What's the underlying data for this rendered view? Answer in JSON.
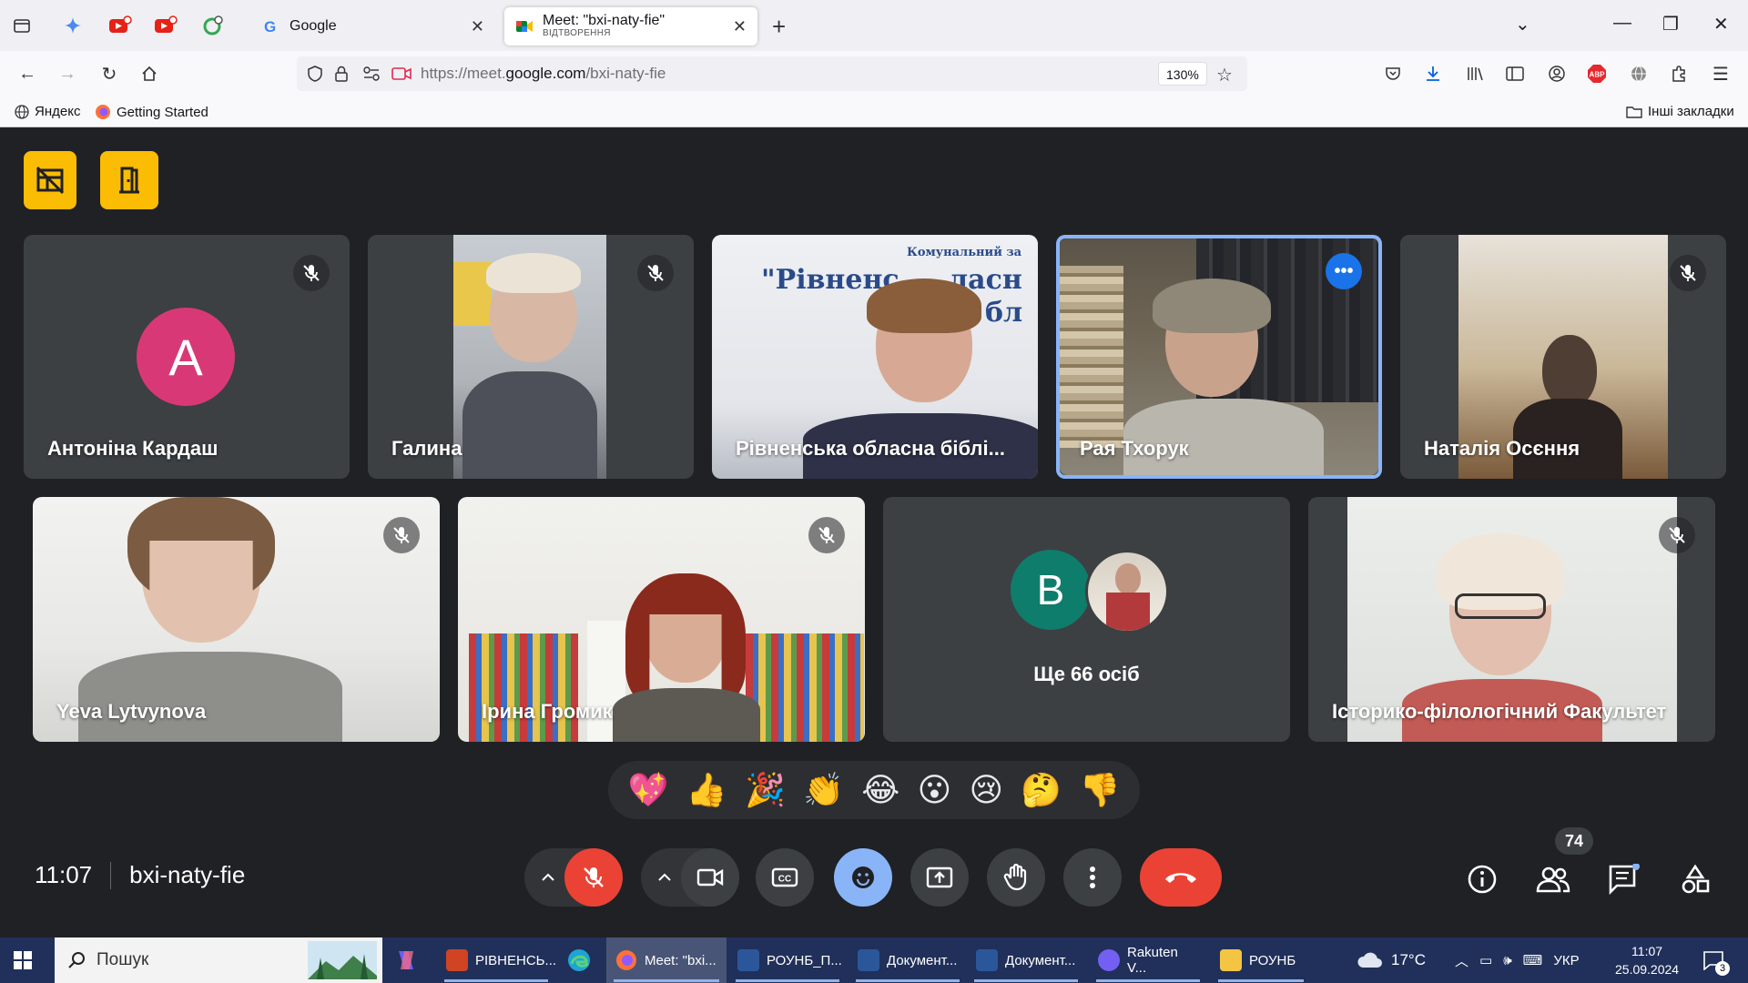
{
  "browser": {
    "tabs": [
      {
        "title": "Google"
      },
      {
        "title": "Meet: \"bxi-naty-fie\"",
        "subtitle": "ВІДТВОРЕННЯ"
      }
    ],
    "url_prefix": "https://meet.",
    "url_domain": "google.com",
    "url_path": "/bxi-naty-fie",
    "zoom": "130%",
    "bookmarks": [
      {
        "label": "Яндекс"
      },
      {
        "label": "Getting Started"
      }
    ],
    "other_bookmarks": "Інші закладки",
    "abp_badge": "ABP"
  },
  "meet": {
    "participants_row1": [
      {
        "name": "Антоніна Кардаш",
        "avatar_letter": "A",
        "avatar_color": "#d93877"
      },
      {
        "name": "Галина"
      },
      {
        "name": "Рівненська обласна біблі..."
      },
      {
        "name": "Рая Тхорук"
      },
      {
        "name": "Наталія Осєння"
      }
    ],
    "participants_row2": [
      {
        "name": "Yeva Lytvynova"
      },
      {
        "name": "Ірина Громик"
      },
      {
        "name": "Ще 66 осіб",
        "avatar_letter": "B",
        "avatar_color": "#0f7d6b"
      },
      {
        "name": "Історико-філологічний Факультет"
      }
    ],
    "background_sign": {
      "line1": "Комунальний за",
      "line2": "\"Рівненс",
      "line3": "ласн",
      "line4": "бл"
    },
    "reactions": [
      "💖",
      "👍",
      "🎉",
      "👏",
      "😂",
      "😮",
      "😢",
      "🤔",
      "👎"
    ],
    "time": "11:07",
    "meeting_code": "bxi-naty-fie",
    "participant_count": "74",
    "accent_colors": {
      "end_call": "#ea4335",
      "mic_off": "#ea4335",
      "reactions_active": "#8ab4f8",
      "highlight": "#fbbc04"
    }
  },
  "taskbar": {
    "search_placeholder": "Пошук",
    "apps": [
      {
        "label": "РІВНЕНСЬ..."
      },
      {
        "label": "Meet: \"bxi..."
      },
      {
        "label": "РОУНБ_П..."
      },
      {
        "label": "Документ..."
      },
      {
        "label": "Документ..."
      },
      {
        "label": "Rakuten V..."
      },
      {
        "label": "РОУНБ"
      }
    ],
    "weather": "17°C",
    "language": "УКР",
    "time": "11:07",
    "date": "25.09.2024",
    "notifications": "3"
  }
}
